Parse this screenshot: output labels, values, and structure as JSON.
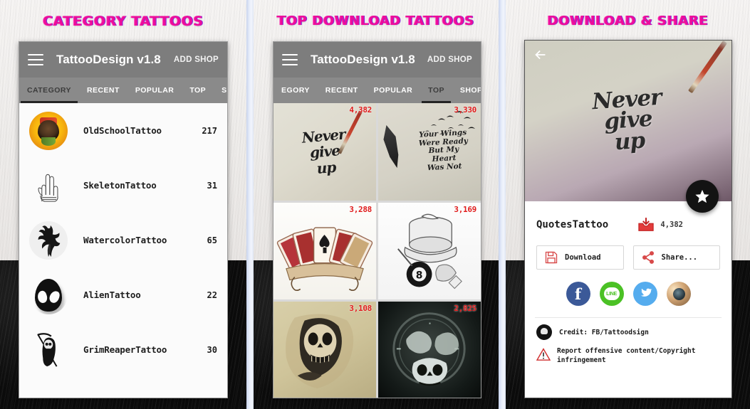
{
  "panels": [
    {
      "promo": "CATEGORY  TATTOOS",
      "appbar": {
        "title": "TattooDesign v1.8",
        "action": "ADD SHOP",
        "menu_icon": "hamburger-icon"
      },
      "tabs": [
        {
          "label": "CATEGORY",
          "active": true
        },
        {
          "label": "RECENT",
          "active": false
        },
        {
          "label": "POPULAR",
          "active": false
        },
        {
          "label": "TOP",
          "active": false
        },
        {
          "label": "SH",
          "active": false
        }
      ],
      "rows": [
        {
          "label": "OldSchoolTattoo",
          "count": "217",
          "icon": "skull-sunflower-icon"
        },
        {
          "label": "SkeletonTattoo",
          "count": "31",
          "icon": "skeleton-hand-icon"
        },
        {
          "label": "WatercolorTattoo",
          "count": "65",
          "icon": "watercolor-bird-icon"
        },
        {
          "label": "AlienTattoo",
          "count": "22",
          "icon": "alien-head-icon"
        },
        {
          "label": "GrimReaperTattoo",
          "count": "30",
          "icon": "grim-reaper-icon"
        }
      ]
    },
    {
      "promo": "TOP DOWNLOAD  TATTOOS",
      "appbar": {
        "title": "TattooDesign v1.8",
        "action": "ADD SHOP",
        "menu_icon": "hamburger-icon"
      },
      "tabs": [
        {
          "label": "EGORY",
          "active": false
        },
        {
          "label": "RECENT",
          "active": false
        },
        {
          "label": "POPULAR",
          "active": false
        },
        {
          "label": "TOP",
          "active": true
        },
        {
          "label": "SHOP",
          "active": false
        }
      ],
      "cells": [
        {
          "count": "4,382",
          "art": "never-give-up",
          "text": "Never\ngive\nup"
        },
        {
          "count": "3,330",
          "art": "wings-feather",
          "text": "Your Wings\nWere Ready\nBut My\nHeart\nWas Not"
        },
        {
          "count": "3,288",
          "art": "playing-cards",
          "text": ""
        },
        {
          "count": "3,169",
          "art": "top-hat-8ball",
          "text": ""
        },
        {
          "count": "3,108",
          "art": "grim-reaper-skull",
          "text": ""
        },
        {
          "count": "2,825",
          "art": "dragon-skull-clock",
          "text": ""
        }
      ]
    },
    {
      "promo": "DOWNLOAD & SHARE",
      "hero": {
        "back_icon": "back-arrow-icon",
        "art": "never-give-up",
        "text": "Never\ngive\nup"
      },
      "favorite": {
        "icon": "star-icon"
      },
      "detail": {
        "title": "QuotesTattoo",
        "download_icon": "download-tray-icon",
        "download_count": "4,382",
        "buttons": [
          {
            "label": "Download",
            "icon": "floppy-save-icon"
          },
          {
            "label": "Share...",
            "icon": "share-nodes-icon"
          }
        ],
        "social": [
          {
            "name": "facebook",
            "label": "f"
          },
          {
            "name": "line",
            "label": "LINE"
          },
          {
            "name": "twitter",
            "label": ""
          },
          {
            "name": "instagram",
            "label": ""
          }
        ],
        "credit": "Credit: FB/Tattoodsign",
        "report": "Report offensive content/Copyright infringement",
        "report_icon": "warning-triangle-icon",
        "credit_icon": "avatar-icon"
      }
    }
  ],
  "colors": {
    "promo_pink": "#ec0d9b",
    "appbar_gray": "#7d7d7d",
    "tabbar_gray": "#8a8a8a",
    "count_red": "#e01b1b",
    "separator_blue": "#dfe6f5",
    "facebook": "#3b5998",
    "line": "#4bc125",
    "twitter": "#55acee"
  }
}
